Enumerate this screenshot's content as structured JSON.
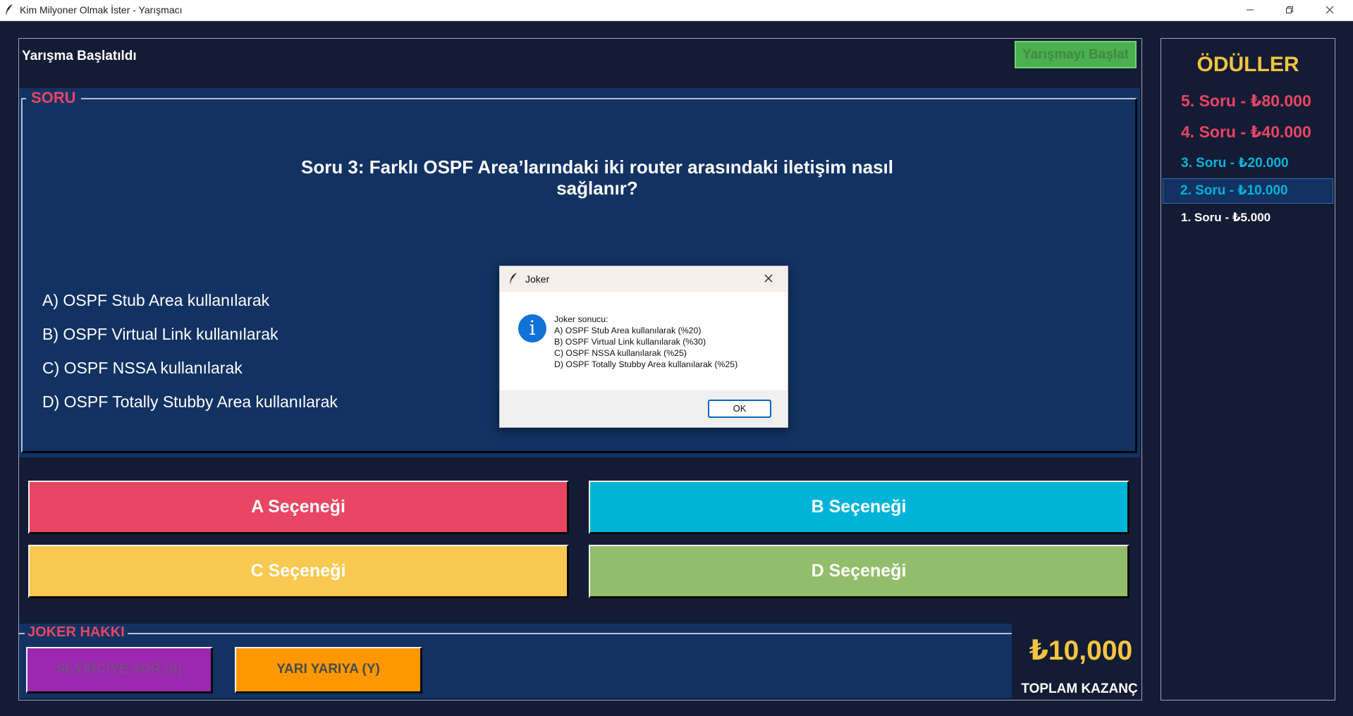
{
  "window": {
    "title": "Kim Milyoner Olmak İster - Yarışmacı",
    "icon": "feather-icon",
    "controls": [
      "minimize-icon",
      "restore-icon",
      "close-icon"
    ]
  },
  "header": {
    "status": "Yarışma Başlatıldı",
    "start_button": "Yarışmayı Başlat"
  },
  "question": {
    "legend": "SORU",
    "text": "Soru 3: Farklı OSPF Area’larındaki iki router arasındaki iletişim nasıl sağlanır?",
    "options": [
      "A) OSPF Stub Area kullanılarak",
      "B) OSPF Virtual Link kullanılarak",
      "C) OSPF NSSA kullanılarak",
      "D) OSPF Totally Stubby Area kullanılarak"
    ]
  },
  "answers": [
    {
      "label": "A Seçeneği",
      "color": "#e84662"
    },
    {
      "label": "B Seçeneği",
      "color": "#00b4d8"
    },
    {
      "label": "C Seçeneği",
      "color": "#f8c850"
    },
    {
      "label": "D Seçeneği",
      "color": "#92be6c"
    }
  ],
  "jokers": {
    "legend": "JOKER HAKKI",
    "audience": "SEYİRCİYE SOR (S)",
    "fifty_fifty": "YARI YARIYA (Y)"
  },
  "total": {
    "amount": "₺10,000",
    "label": "TOPLAM KAZANÇ"
  },
  "prizes": {
    "title": "ÖDÜLLER",
    "items": [
      {
        "label": "5. Soru - ₺80.000",
        "color": "#e84662"
      },
      {
        "label": "4. Soru - ₺40.000",
        "color": "#e84662"
      },
      {
        "label": "3. Soru - ₺20.000",
        "color": "#00b4d8"
      },
      {
        "label": "2. Soru - ₺10.000",
        "color": "#00b4d8",
        "active": true
      },
      {
        "label": "1. Soru - ₺5.000",
        "color": "#ffffff"
      }
    ]
  },
  "dialog": {
    "title": "Joker",
    "icon": "info-icon",
    "lines": [
      "Joker sonucu:",
      "A) OSPF Stub Area kullanılarak (%20)",
      "B) OSPF Virtual Link kullanılarak (%30)",
      "C) OSPF NSSA kullanılarak (%25)",
      "D) OSPF Totally Stubby Area kullanılarak (%25)"
    ],
    "ok": "OK"
  }
}
